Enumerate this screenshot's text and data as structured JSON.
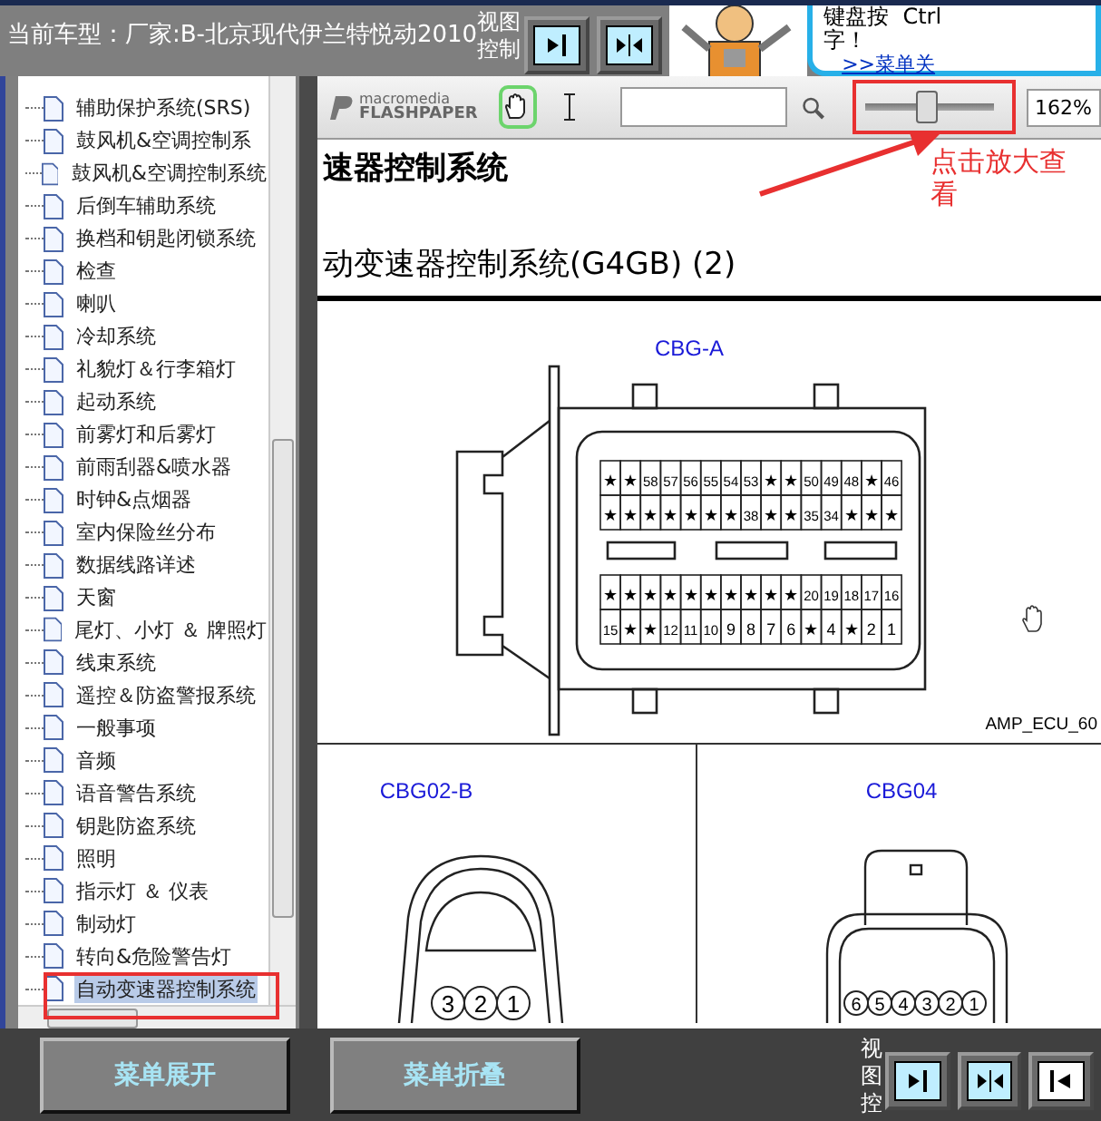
{
  "header": {
    "title": "当前车型：厂家:B-北京现代伊兰特悦动2010",
    "view_label": "视图控制",
    "view_buttons": [
      {
        "kind": "right"
      },
      {
        "kind": "both"
      }
    ]
  },
  "tip": {
    "line_1": "键盘按",
    "key": "Ctrl",
    "line_2": "字！",
    "link": ">>菜单关"
  },
  "tree": {
    "items": [
      {
        "label": "辅助保护系统(SRS)",
        "selected": false
      },
      {
        "label": "鼓风机&空调控制系",
        "selected": false
      },
      {
        "label": "鼓风机&空调控制系统",
        "selected": false
      },
      {
        "label": "后倒车辅助系统",
        "selected": false
      },
      {
        "label": "换档和钥匙闭锁系统",
        "selected": false
      },
      {
        "label": "检查",
        "selected": false
      },
      {
        "label": "喇叭",
        "selected": false
      },
      {
        "label": "冷却系统",
        "selected": false
      },
      {
        "label": "礼貌灯＆行李箱灯",
        "selected": false
      },
      {
        "label": "起动系统",
        "selected": false
      },
      {
        "label": "前雾灯和后雾灯",
        "selected": false
      },
      {
        "label": "前雨刮器&喷水器",
        "selected": false
      },
      {
        "label": "时钟&点烟器",
        "selected": false
      },
      {
        "label": "室内保险丝分布",
        "selected": false
      },
      {
        "label": "数据线路详述",
        "selected": false
      },
      {
        "label": "天窗",
        "selected": false
      },
      {
        "label": "尾灯、小灯 ＆ 牌照灯",
        "selected": false
      },
      {
        "label": "线束系统",
        "selected": false
      },
      {
        "label": "遥控＆防盗警报系统",
        "selected": false
      },
      {
        "label": "一般事项",
        "selected": false
      },
      {
        "label": "音频",
        "selected": false
      },
      {
        "label": "语音警告系统",
        "selected": false
      },
      {
        "label": "钥匙防盗系统",
        "selected": false
      },
      {
        "label": "照明",
        "selected": false
      },
      {
        "label": "指示灯 ＆ 仪表",
        "selected": false
      },
      {
        "label": "制动灯",
        "selected": false
      },
      {
        "label": "转向&危险警告灯",
        "selected": false
      },
      {
        "label": "自动变速器控制系统",
        "selected": true
      }
    ]
  },
  "viewer": {
    "logo_top": "macromedia",
    "logo_bottom": "FLASHPAPER",
    "tools": [
      {
        "kind": "hand",
        "selected": true
      },
      {
        "kind": "text",
        "selected": false
      }
    ],
    "zoom": {
      "level": 0.48,
      "reading": "162%"
    }
  },
  "annotation": {
    "text": "点击放大查看"
  },
  "document": {
    "heading": "速器控制系统",
    "title": "动变速器控制系统(G4GB) (2)",
    "main_connector": {
      "label": "CBG-A",
      "code": "AMP_ECU_60",
      "pin_rows": [
        [
          "★",
          "★",
          "58",
          "57",
          "56",
          "55",
          "54",
          "53",
          "★",
          "★",
          "50",
          "49",
          "48",
          "★",
          "46"
        ],
        [
          "★",
          "★",
          "★",
          "★",
          "★",
          "★",
          "★",
          "38",
          "★",
          "★",
          "35",
          "34",
          "★",
          "★",
          "★"
        ],
        [
          "★",
          "★",
          "★",
          "★",
          "★",
          "★",
          "★",
          "★",
          "★",
          "★",
          "20",
          "19",
          "18",
          "17",
          "16"
        ],
        [
          "15",
          "★",
          "★",
          "12",
          "11",
          "10",
          "9",
          "8",
          "7",
          "6",
          "★",
          "4",
          "★",
          "2",
          "1"
        ]
      ]
    },
    "small_connectors": [
      {
        "label": "CBG02-B",
        "pins": [
          "3",
          "2",
          "1"
        ]
      },
      {
        "label": "CBG04",
        "pins": [
          "6",
          "5",
          "4",
          "3",
          "2",
          "1"
        ]
      }
    ]
  },
  "footer": {
    "buttons": [
      "菜单展开",
      "菜单折叠"
    ],
    "view_label": "视图控",
    "view_buttons": [
      {
        "kind": "right"
      },
      {
        "kind": "both"
      },
      {
        "kind": "left"
      }
    ]
  }
}
